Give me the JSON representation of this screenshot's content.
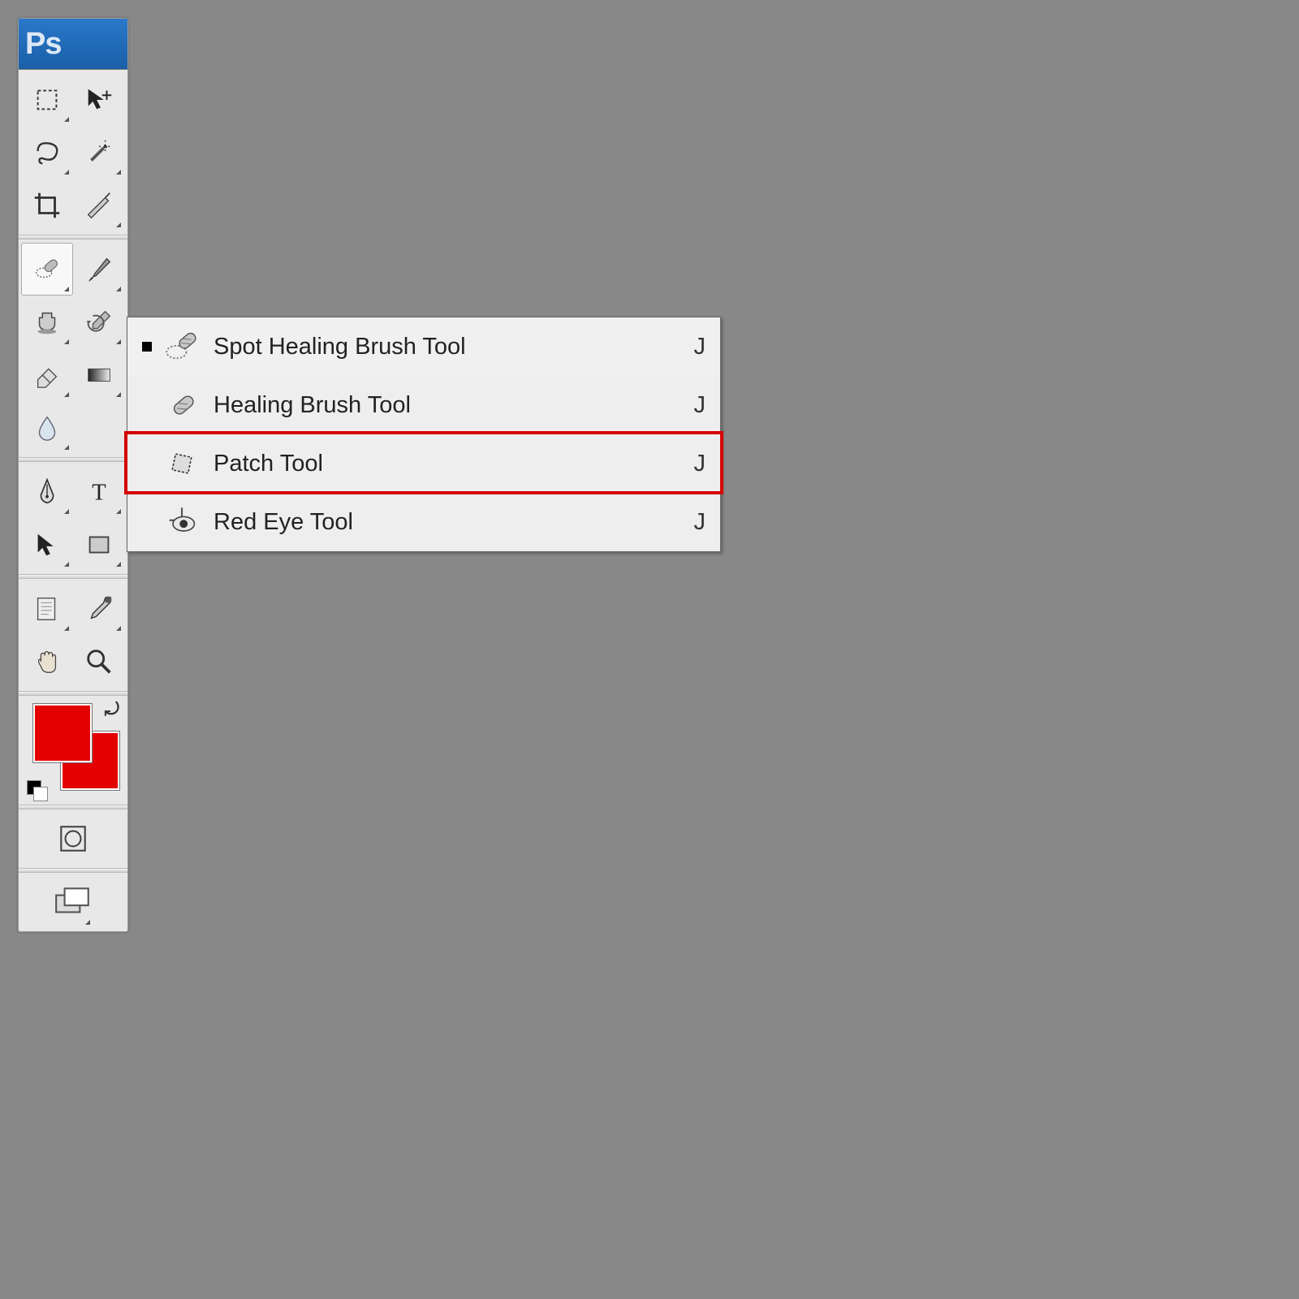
{
  "app": {
    "logo_text": "Ps"
  },
  "colors": {
    "foreground": "#e30000",
    "background": "#e30000"
  },
  "flyout": {
    "items": [
      {
        "label": "Spot Healing Brush Tool",
        "shortcut": "J",
        "selected": true,
        "icon": "spot-healing-brush-icon"
      },
      {
        "label": "Healing Brush Tool",
        "shortcut": "J",
        "selected": false,
        "icon": "healing-brush-icon"
      },
      {
        "label": "Patch Tool",
        "shortcut": "J",
        "selected": false,
        "icon": "patch-icon",
        "highlighted": true
      },
      {
        "label": "Red Eye Tool",
        "shortcut": "J",
        "selected": false,
        "icon": "red-eye-icon"
      }
    ]
  },
  "toolbox_tools": [
    [
      "marquee",
      "move"
    ],
    [
      "lasso",
      "magic-wand"
    ],
    [
      "crop",
      "slice"
    ],
    "---",
    [
      "spot-healing",
      "brush"
    ],
    [
      "clone-stamp",
      "history-brush"
    ],
    [
      "eraser",
      "gradient"
    ],
    [
      "blur",
      ""
    ],
    "---",
    [
      "pen",
      "type"
    ],
    [
      "path-select",
      "rectangle"
    ],
    "---",
    [
      "notes",
      "eyedropper"
    ],
    [
      "hand",
      "zoom"
    ],
    "---",
    "colors",
    "---",
    [
      "quickmask"
    ],
    "---",
    [
      "screenmode"
    ]
  ]
}
